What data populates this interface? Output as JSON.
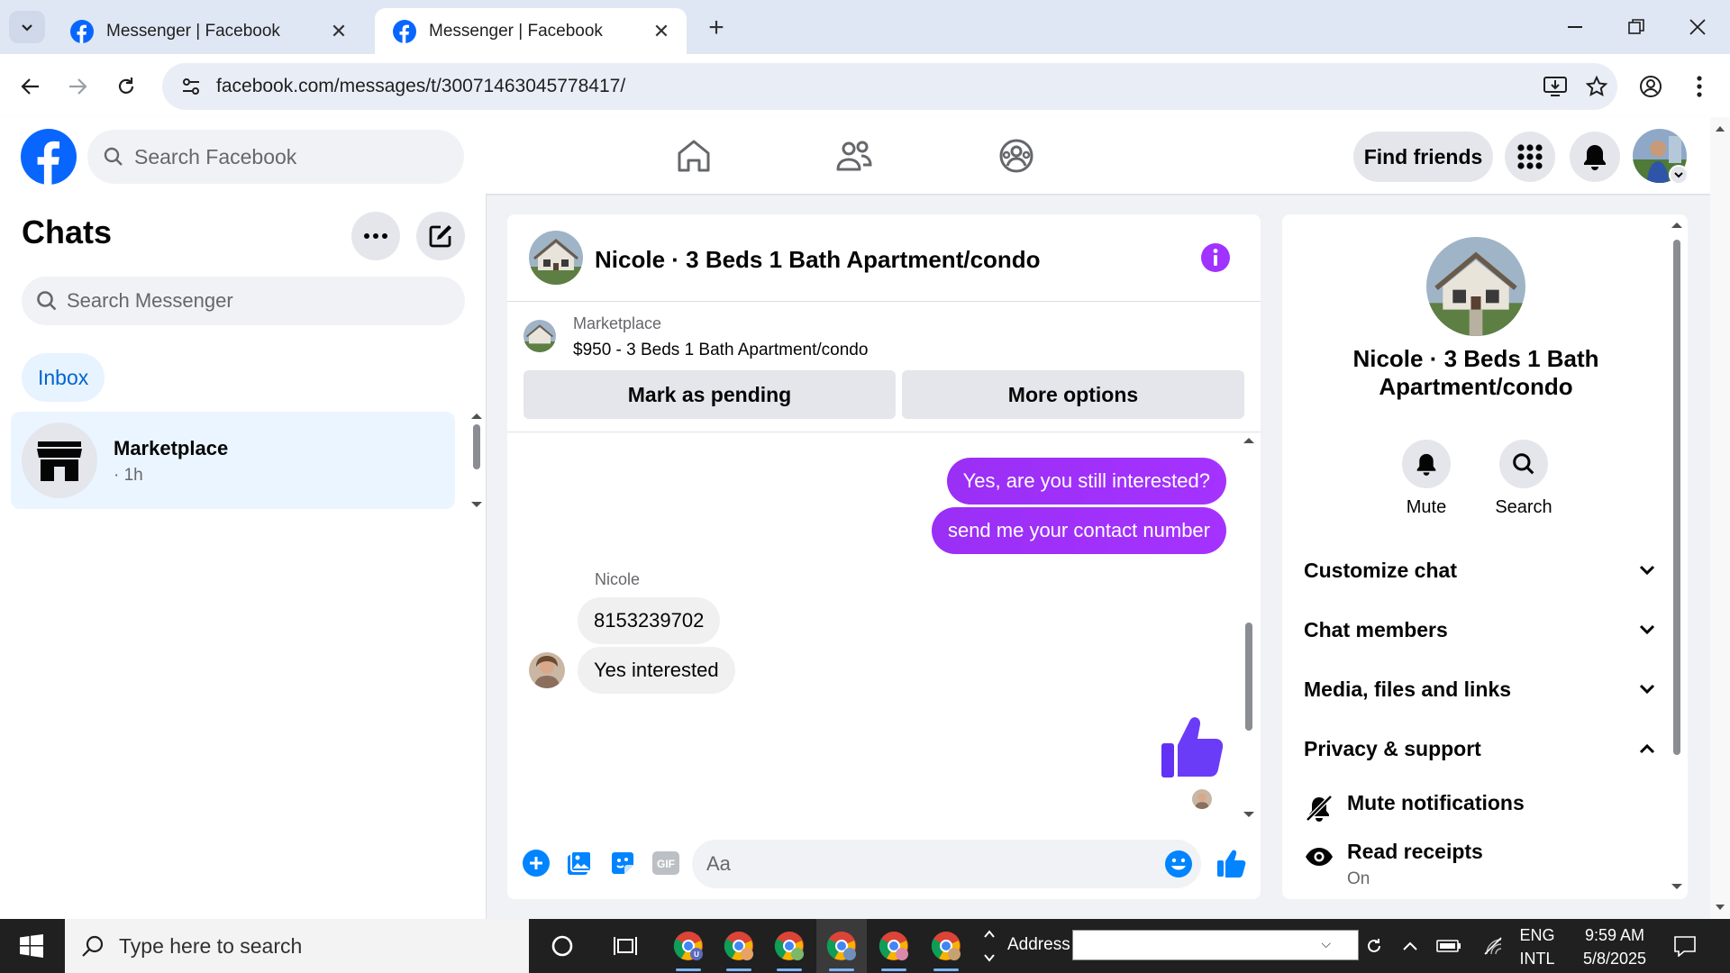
{
  "browser": {
    "tabs": [
      {
        "title": "Messenger | Facebook"
      },
      {
        "title": "Messenger | Facebook"
      }
    ],
    "url": "facebook.com/messages/t/30071463045778417/"
  },
  "facebook": {
    "search_placeholder": "Search Facebook",
    "find_friends": "Find friends"
  },
  "sidebar": {
    "title": "Chats",
    "search_placeholder": "Search Messenger",
    "filter": "Inbox",
    "chats": [
      {
        "name": "Marketplace",
        "time": "· 1h"
      }
    ]
  },
  "conversation": {
    "title": "Nicole · 3 Beds 1 Bath Apartment/condo",
    "marketplace_label": "Marketplace",
    "listing": "$950 - 3 Beds 1 Bath Apartment/condo",
    "mark_pending": "Mark as pending",
    "more_options": "More options",
    "messages": [
      {
        "from": "me",
        "text": "Yes, are you still interested?"
      },
      {
        "from": "me",
        "text": "send me your contact number"
      },
      {
        "from": "Nicole",
        "text": "8153239702"
      },
      {
        "from": "Nicole",
        "text": "Yes interested"
      }
    ],
    "sender_name": "Nicole",
    "composer_placeholder": "Aa",
    "colors": {
      "accent": "#a033ff",
      "messenger_blue": "#0084ff"
    }
  },
  "info_panel": {
    "name": "Nicole · 3 Beds 1 Bath Apartment/condo",
    "actions": [
      {
        "label": "Mute",
        "icon": "bell-icon"
      },
      {
        "label": "Search",
        "icon": "search-icon"
      }
    ],
    "sections": [
      {
        "label": "Customize chat",
        "expanded": false
      },
      {
        "label": "Chat members",
        "expanded": false
      },
      {
        "label": "Media, files and links",
        "expanded": false
      },
      {
        "label": "Privacy & support",
        "expanded": true
      }
    ],
    "privacy_items": [
      {
        "label": "Mute notifications",
        "value": ""
      },
      {
        "label": "Read receipts",
        "value": "On"
      }
    ]
  },
  "taskbar": {
    "search_placeholder": "Type here to search",
    "address_label": "Address",
    "language": "ENG",
    "layout": "INTL",
    "time": "9:59 AM",
    "date": "5/8/2025"
  }
}
